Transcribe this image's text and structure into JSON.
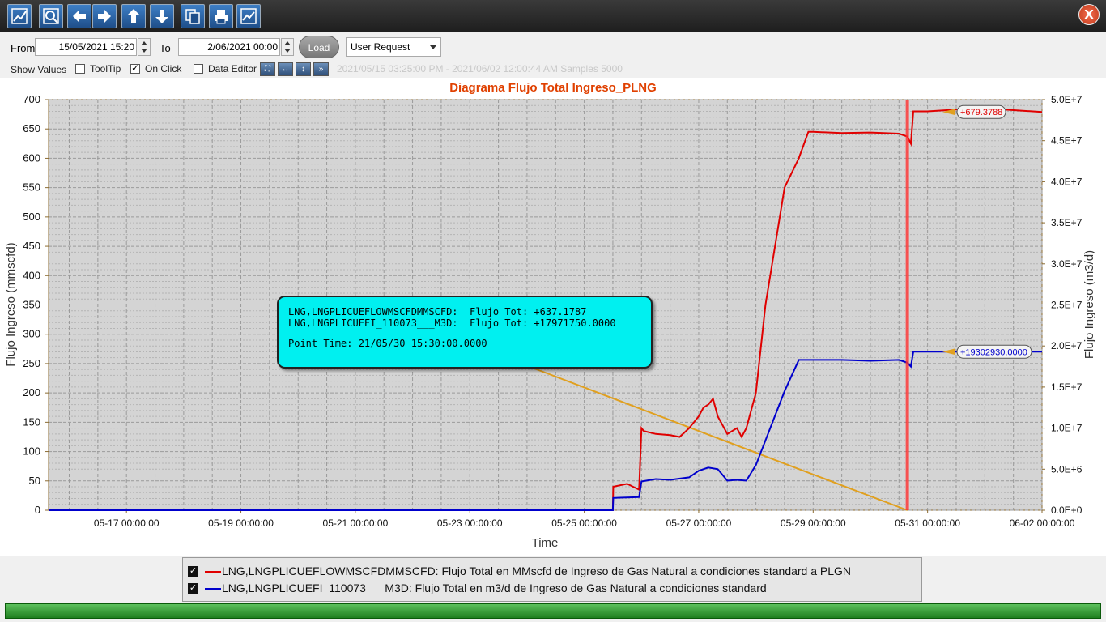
{
  "toolbar": {
    "icons": [
      "settings-chart-icon",
      "zoom-icon",
      "arrow-left-icon",
      "arrow-right-icon",
      "arrow-up-icon",
      "arrow-down-icon",
      "copy-icon",
      "print-icon",
      "chart-icon"
    ],
    "close_label": "X"
  },
  "controls": {
    "from_label": "From",
    "from_value": "15/05/2021 15:20",
    "to_label": "To",
    "to_value": "2/06/2021 00:00",
    "load_label": "Load",
    "mode_value": "User Request",
    "show_values_label": "Show Values",
    "tooltip_label": "ToolTip",
    "tooltip_checked": false,
    "onclick_label": "On Click",
    "onclick_checked": true,
    "data_editor_label": "Data Editor",
    "data_editor_checked": false,
    "range_info": "2021/05/15 03:25:00 PM - 2021/06/02 12:00:44 AM  Samples 5000"
  },
  "tooltip_box": {
    "line1": "LNG,LNGPLICUEFLOWMSCFDMMSCFD:  Flujo Tot: +637.1787",
    "line2": "LNG,LNGPLICUEFI_110073___M3D:  Flujo Tot: +17971750.0000",
    "line3": "Point Time: 21/05/30 15:30:00.0000"
  },
  "legend": [
    {
      "checked": true,
      "color": "#e00000",
      "text": "LNG,LNGPLICUEFLOWMSCFDMMSCFD:  Flujo Total en MMscfd de Ingreso de Gas Natural a condiciones standard a PLGN"
    },
    {
      "checked": true,
      "color": "#0000cc",
      "text": "LNG,LNGPLICUEFI_110073___M3D:  Flujo Total en m3/d de Ingreso de Gas Natural a condiciones standard"
    }
  ],
  "chart_data": {
    "type": "line",
    "title": "Diagrama Flujo Total Ingreso_PLNG",
    "xlabel": "Time",
    "ylabel": "Flujo Ingreso (mmscfd)",
    "y2label": "Flujo Ingreso (m3/d)",
    "x_range": [
      "2021-05-15 15:20:00",
      "2021-06-02 00:00:00"
    ],
    "x_ticks": [
      "05-17 00:00:00",
      "05-19 00:00:00",
      "05-21 00:00:00",
      "05-23 00:00:00",
      "05-25 00:00:00",
      "05-27 00:00:00",
      "05-29 00:00:00",
      "05-31 00:00:00",
      "06-02 00:00:00"
    ],
    "ylim": [
      0,
      700
    ],
    "y_ticks": [
      "0",
      "50",
      "100",
      "150",
      "200",
      "250",
      "300",
      "350",
      "400",
      "450",
      "500",
      "550",
      "600",
      "650",
      "700"
    ],
    "y2lim": [
      0,
      50000000
    ],
    "y2_ticks": [
      "0.0E+0",
      "5.0E+6",
      "1.0E+7",
      "1.5E+7",
      "2.0E+7",
      "2.5E+7",
      "3.0E+7",
      "3.5E+7",
      "4.0E+7",
      "4.5E+7",
      "5.0E+7"
    ],
    "grid": true,
    "cursor_time": "2021-05-30 15:30:00",
    "series": [
      {
        "name": "LNG,LNGPLICUEFLOWMSCFDMMSCFD",
        "color": "#e00000",
        "axis": "left",
        "last_value_label": "+679.3788",
        "x": [
          "2021-05-15 15:20",
          "2021-05-25 12:00",
          "2021-05-25 12:10",
          "2021-05-25 18:00",
          "2021-05-25 23:00",
          "2021-05-26 00:00",
          "2021-05-26 01:00",
          "2021-05-26 06:00",
          "2021-05-26 12:00",
          "2021-05-26 16:00",
          "2021-05-26 20:00",
          "2021-05-27 00:00",
          "2021-05-27 02:00",
          "2021-05-27 04:00",
          "2021-05-27 06:00",
          "2021-05-27 08:00",
          "2021-05-27 12:00",
          "2021-05-27 16:00",
          "2021-05-27 18:00",
          "2021-05-27 20:00",
          "2021-05-28 00:00",
          "2021-05-28 04:00",
          "2021-05-28 08:00",
          "2021-05-28 12:00",
          "2021-05-28 18:00",
          "2021-05-28 22:00",
          "2021-05-29 00:00",
          "2021-05-29 12:00",
          "2021-05-30 00:00",
          "2021-05-30 12:00",
          "2021-05-30 15:30",
          "2021-05-30 17:00",
          "2021-05-30 18:00",
          "2021-05-31 00:00",
          "2021-05-31 12:00",
          "2021-06-01 00:00",
          "2021-06-01 12:00",
          "2021-06-02 00:00"
        ],
        "y": [
          0,
          0,
          40,
          45,
          35,
          140,
          135,
          130,
          128,
          125,
          140,
          160,
          175,
          180,
          190,
          160,
          130,
          140,
          125,
          140,
          200,
          350,
          450,
          550,
          600,
          645,
          645,
          643,
          644,
          642,
          637,
          625,
          680,
          680,
          683,
          685,
          682,
          679
        ]
      },
      {
        "name": "LNG,LNGPLICUEFI_110073___M3D",
        "color": "#0000cc",
        "axis": "right",
        "last_value_label": "+19302930.0000",
        "x": [
          "2021-05-15 15:20",
          "2021-05-25 12:00",
          "2021-05-25 12:10",
          "2021-05-25 23:00",
          "2021-05-26 00:00",
          "2021-05-26 06:00",
          "2021-05-26 12:00",
          "2021-05-26 20:00",
          "2021-05-27 00:00",
          "2021-05-27 04:00",
          "2021-05-27 08:00",
          "2021-05-27 12:00",
          "2021-05-27 16:00",
          "2021-05-27 20:00",
          "2021-05-28 00:00",
          "2021-05-28 04:00",
          "2021-05-28 08:00",
          "2021-05-28 12:00",
          "2021-05-28 18:00",
          "2021-05-29 00:00",
          "2021-05-29 12:00",
          "2021-05-30 00:00",
          "2021-05-30 12:00",
          "2021-05-30 15:30",
          "2021-05-30 17:00",
          "2021-05-30 18:00",
          "2021-05-31 00:00",
          "2021-05-31 12:00",
          "2021-06-01 00:00",
          "2021-06-01 12:00",
          "2021-06-02 00:00"
        ],
        "y": [
          0,
          0,
          1500000,
          1600000,
          3500000,
          3800000,
          3700000,
          4000000,
          4800000,
          5200000,
          5000000,
          3600000,
          3700000,
          3600000,
          5500000,
          8500000,
          11500000,
          14500000,
          18300000,
          18300000,
          18300000,
          18200000,
          18300000,
          17971750,
          17500000,
          19300000,
          19300000,
          19300000,
          19350000,
          19300000,
          19302930
        ]
      }
    ]
  }
}
